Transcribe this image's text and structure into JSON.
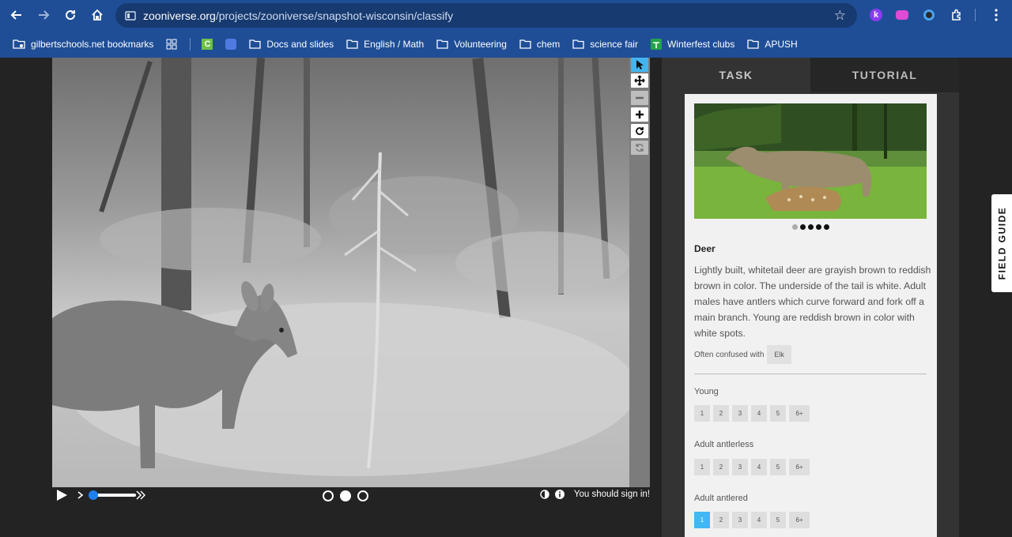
{
  "browser": {
    "url_host": "zooniverse.org",
    "url_path": "/projects/zooniverse/snapshot-wisconsin/classify"
  },
  "bookmarks": [
    {
      "label": "gilbertschools.net bookmarks"
    },
    {
      "label": "Docs and slides"
    },
    {
      "label": "English / Math"
    },
    {
      "label": "Volunteering"
    },
    {
      "label": "chem"
    },
    {
      "label": "science fair"
    },
    {
      "label": "Winterfest clubs"
    },
    {
      "label": "APUSH"
    }
  ],
  "viewer": {
    "sign_in_text": "You should sign in!",
    "frames": 3,
    "active_frame": 2
  },
  "tabs": {
    "task": "TASK",
    "tutorial": "TUTORIAL"
  },
  "field_guide": "FIELD GUIDE",
  "species": {
    "name": "Deer",
    "description": "Lightly built, whitetail deer are grayish brown to reddish brown in color. The underside of the tail is white. Adult males have antlers which curve forward and fork off a main branch. Young are reddish brown in color with white spots.",
    "confused_label": "Often confused with",
    "confused_with": "Elk",
    "image_count": 5,
    "image_active": 1
  },
  "questions": [
    {
      "label": "Young",
      "options": [
        "1",
        "2",
        "3",
        "4",
        "5",
        "6+"
      ],
      "selected": null
    },
    {
      "label": "Adult antlerless",
      "options": [
        "1",
        "2",
        "3",
        "4",
        "5",
        "6+"
      ],
      "selected": null
    },
    {
      "label": "Adult antlered",
      "options": [
        "1",
        "2",
        "3",
        "4",
        "5",
        "6+"
      ],
      "selected": "1"
    }
  ],
  "colors": {
    "chrome": "#1f4e97",
    "accent": "#40b8f2"
  }
}
